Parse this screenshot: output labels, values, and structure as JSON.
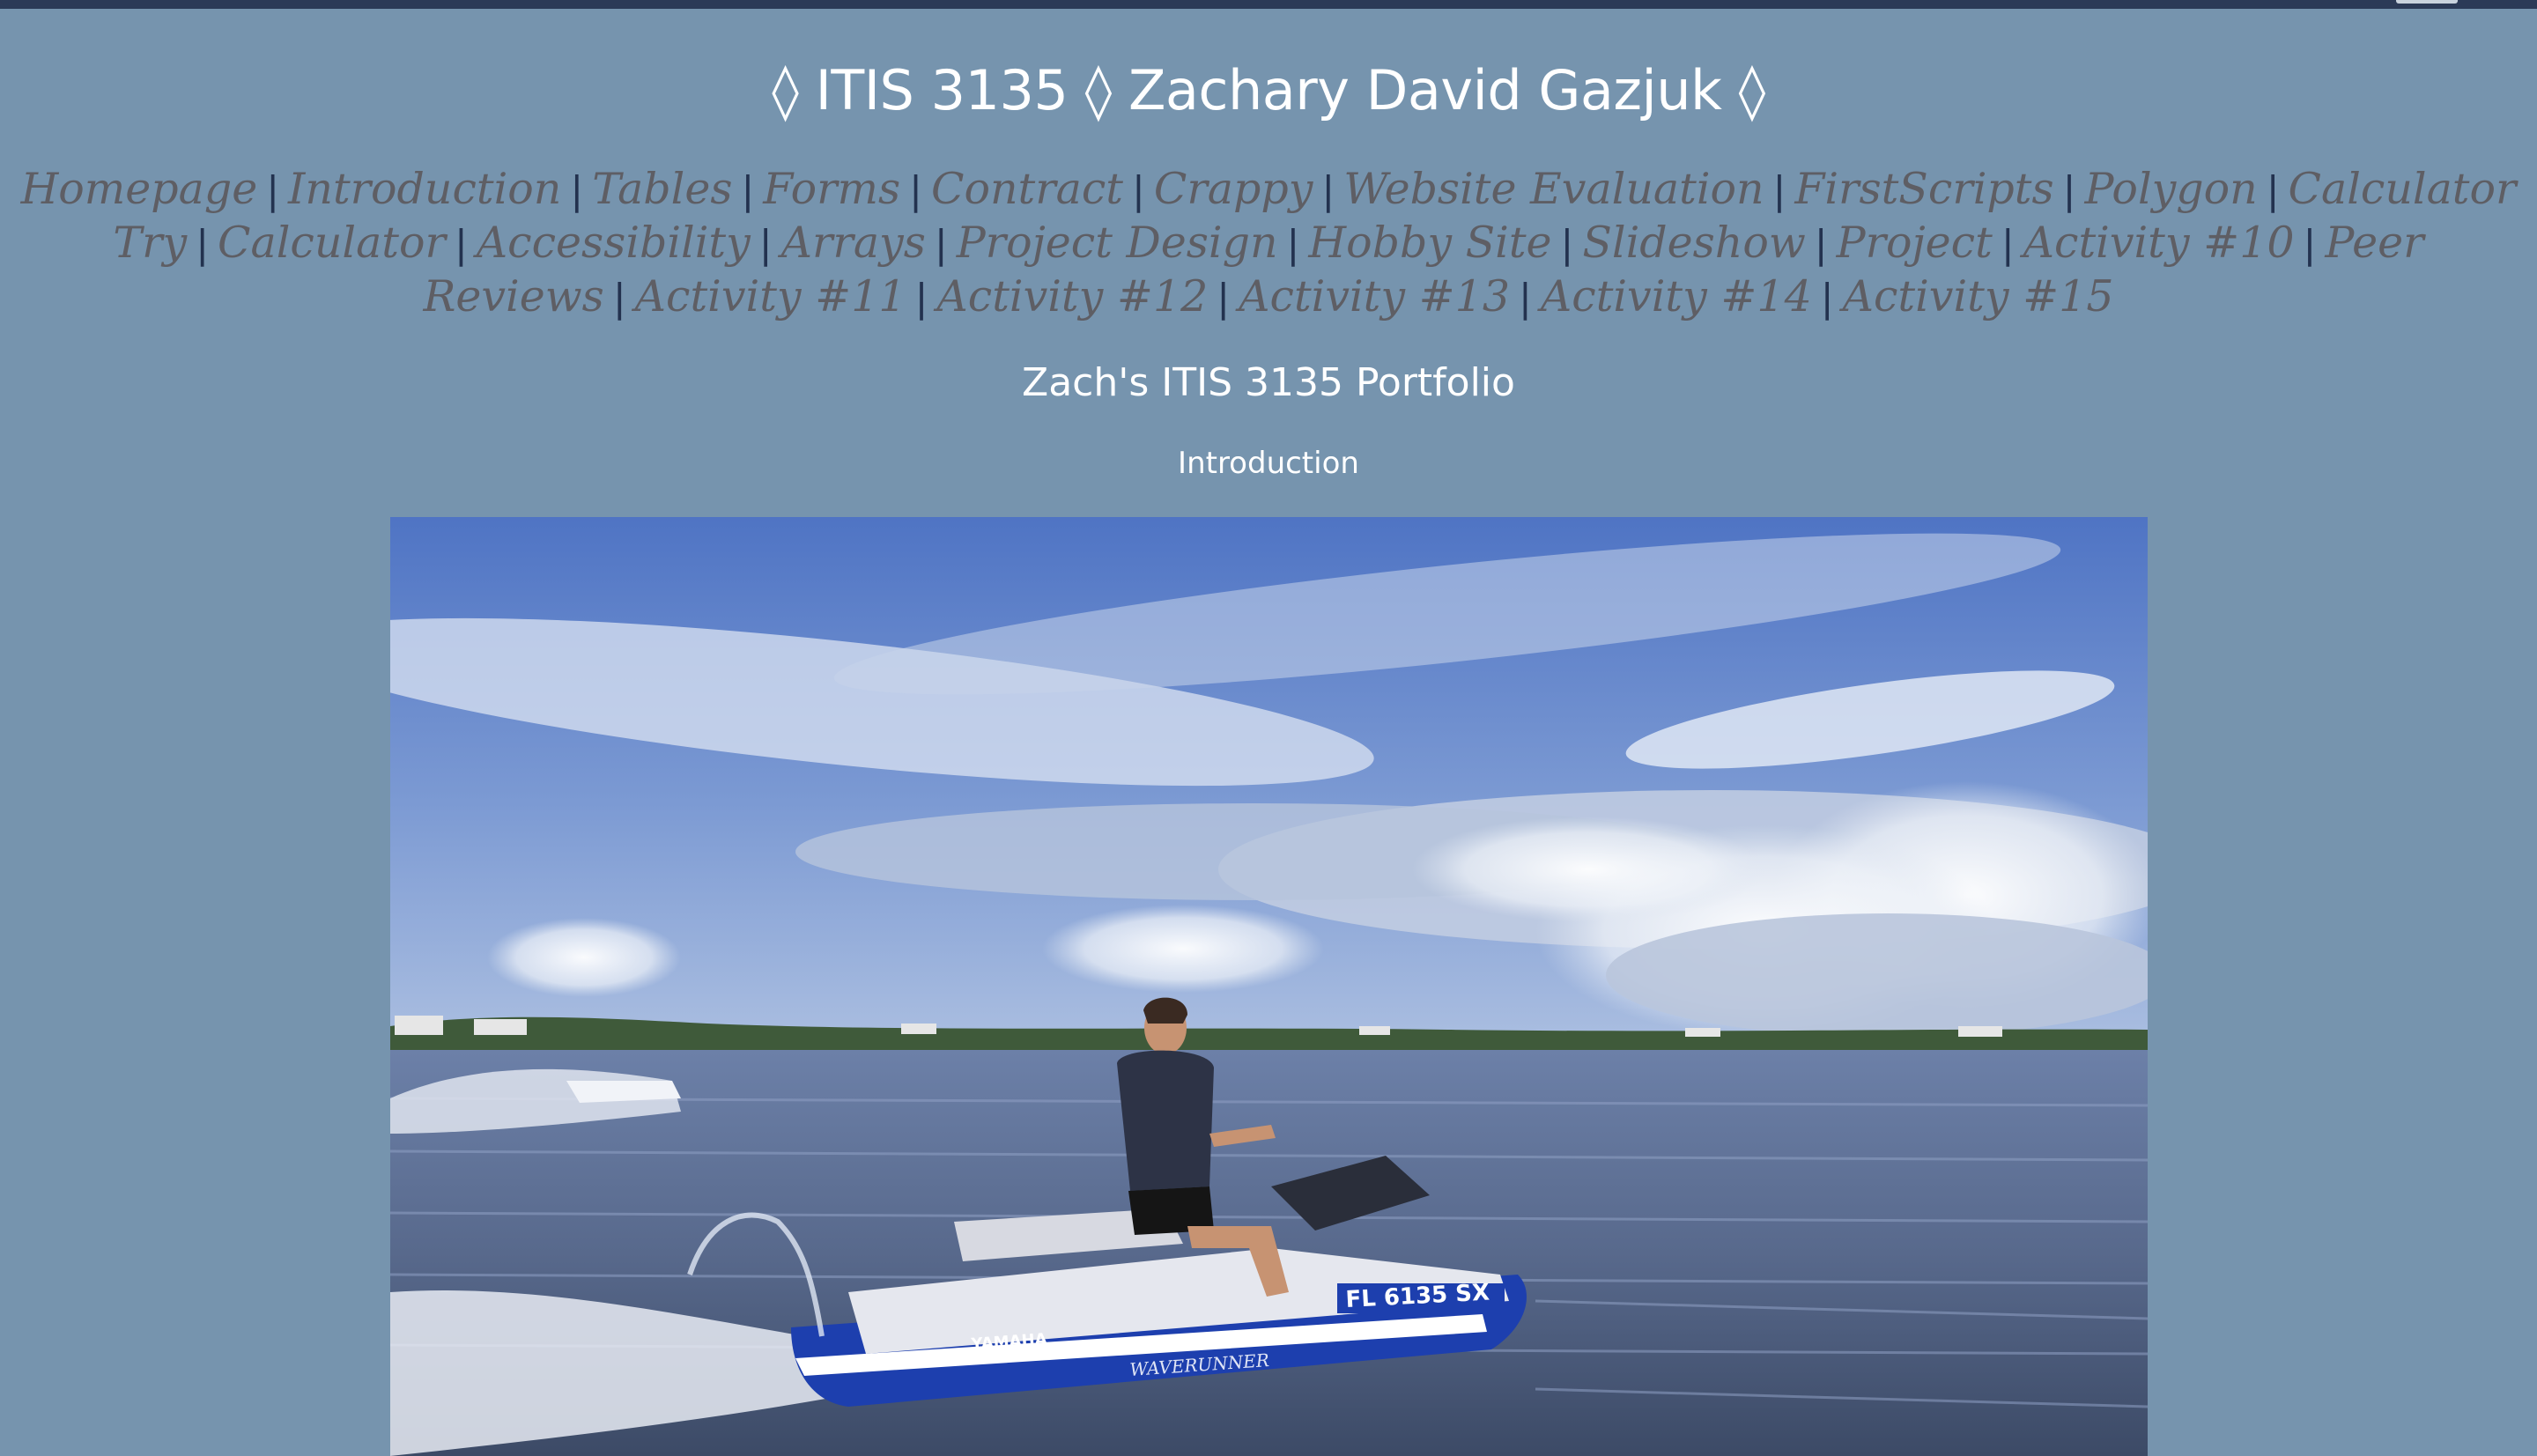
{
  "header": {
    "title": "◊ ITIS 3135 ◊ Zachary David Gazjuk ◊"
  },
  "nav": {
    "links": [
      "Homepage",
      "Introduction",
      "Tables",
      "Forms",
      "Contract",
      "Crappy",
      "Website Evaluation",
      "FirstScripts",
      "Polygon",
      "Calculator Try",
      "Calculator",
      "Accessibility",
      "Arrays",
      "Project Design",
      "Hobby Site",
      "Slideshow",
      "Project",
      "Activity #10",
      "Peer Reviews",
      "Activity #11",
      "Activity #12",
      "Activity #13",
      "Activity #14",
      "Activity #15"
    ],
    "separator": "|"
  },
  "main": {
    "subtitle": "Zach's ITIS 3135 Portfolio",
    "section_heading": "Introduction"
  },
  "photo": {
    "registration": "FL 6135 SX",
    "brand": "YAMAHA",
    "model": "WAVERUNNER"
  },
  "colors": {
    "page_background": "#7694ae",
    "topbar": "#2b3a57",
    "nav_link": "#5e5e64",
    "separator": "#23324f",
    "heading_text": "#ffffff"
  }
}
